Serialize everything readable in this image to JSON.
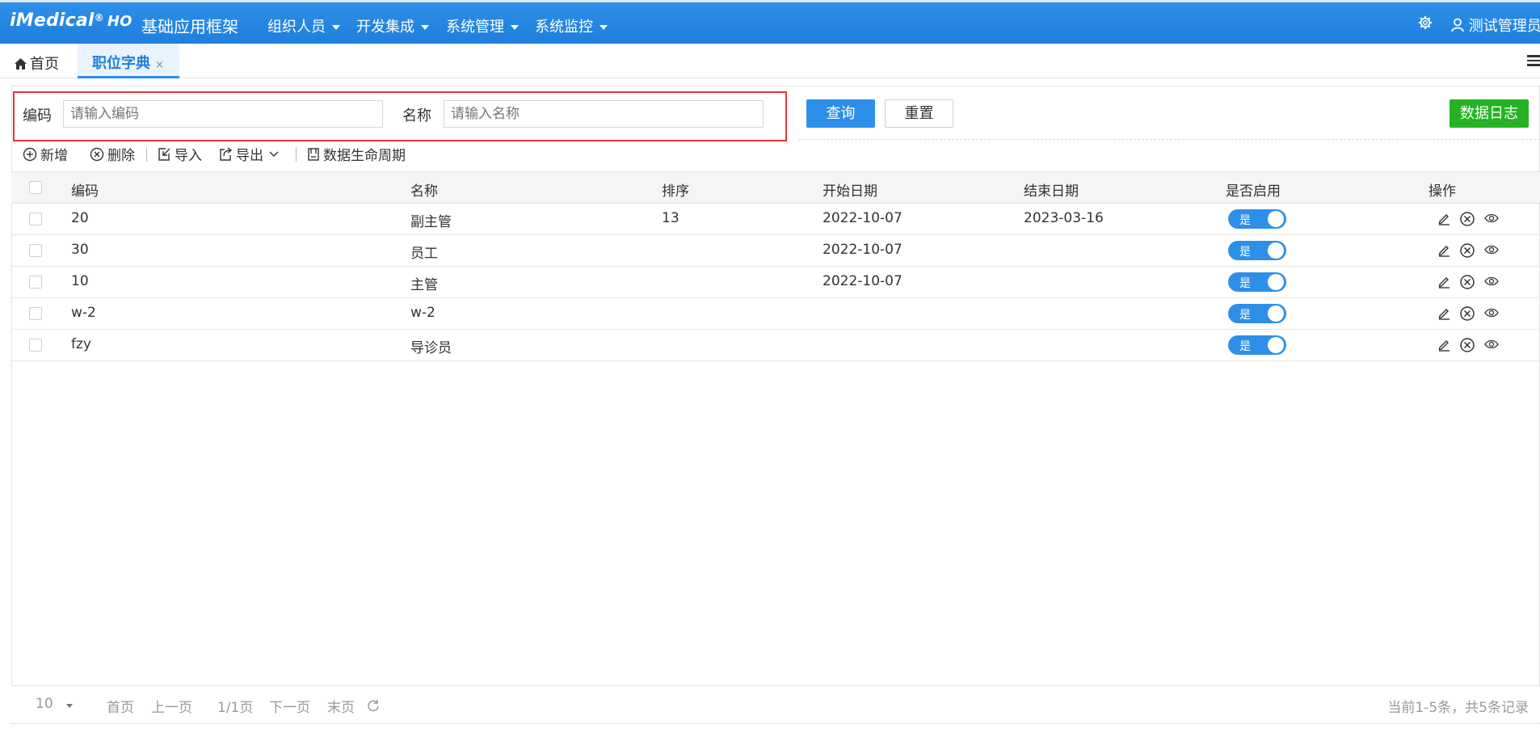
{
  "header": {
    "brand": "iMedical",
    "brand_reg": "®",
    "brand_suffix": "HO",
    "title": "基础应用框架",
    "menus": [
      "组织人员",
      "开发集成",
      "系统管理",
      "系统监控"
    ],
    "settings_icon": "gear-icon",
    "user_icon": "user-icon",
    "user_name": "测试管理员"
  },
  "tabs": {
    "home_icon": "home-icon",
    "home_label": "首页",
    "active_label": "职位字典",
    "close_glyph": "×"
  },
  "search": {
    "code_label": "编码",
    "code_placeholder": "请输入编码",
    "name_label": "名称",
    "name_placeholder": "请输入名称",
    "query_button": "查询",
    "reset_button": "重置",
    "log_button": "数据日志"
  },
  "toolbar": {
    "add": "新增",
    "delete": "删除",
    "import": "导入",
    "export": "导出",
    "lifecycle": "数据生命周期"
  },
  "table": {
    "columns": [
      "编码",
      "名称",
      "排序",
      "开始日期",
      "结束日期",
      "是否启用",
      "操作"
    ],
    "rows": [
      {
        "code": "20",
        "name": "副主管",
        "sort": "13",
        "start": "2022-10-07",
        "end": "2023-03-16",
        "enabled": "是"
      },
      {
        "code": "30",
        "name": "员工",
        "sort": "",
        "start": "2022-10-07",
        "end": "",
        "enabled": "是"
      },
      {
        "code": "10",
        "name": "主管",
        "sort": "",
        "start": "2022-10-07",
        "end": "",
        "enabled": "是"
      },
      {
        "code": "w-2",
        "name": "w-2",
        "sort": "",
        "start": "",
        "end": "",
        "enabled": "是"
      },
      {
        "code": "fzy",
        "name": "导诊员",
        "sort": "",
        "start": "",
        "end": "",
        "enabled": "是"
      }
    ]
  },
  "pager": {
    "page_size": "10",
    "first": "首页",
    "prev": "上一页",
    "page_info": "1/1页",
    "next": "下一页",
    "last": "末页",
    "summary": "当前1-5条，共5条记录"
  },
  "colors": {
    "primary": "#2e8fe8",
    "success": "#25b325",
    "highlight_border": "#e8353b"
  }
}
